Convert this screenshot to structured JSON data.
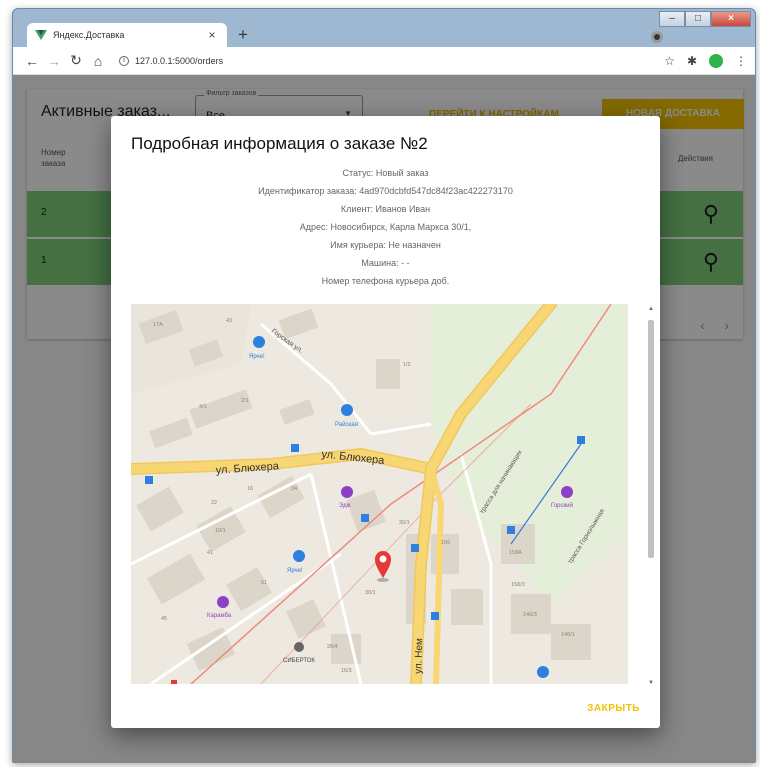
{
  "browser": {
    "tab_title": "Яндекс.Доставка",
    "tab_close": "×",
    "new_tab": "+",
    "url": "127.0.0.1:5000/orders",
    "win_minimize": "–",
    "win_maximize": "□",
    "win_close": "×"
  },
  "page": {
    "card_title": "Активные заказ...",
    "filter_label": "Фильтр заказов",
    "filter_value": "Все",
    "settings_link": "ПЕРЕЙТИ К НАСТРОЙКАМ",
    "new_delivery_button": "НОВАЯ ДОСТАВКА",
    "columns": {
      "order_number_1": "Номер",
      "order_number_2": "заказа",
      "actions": "Действия"
    },
    "rows": [
      {
        "num": "2"
      },
      {
        "num": "1"
      }
    ]
  },
  "dialog": {
    "title": "Подробная информация о заказе №2",
    "status": "Статус: Новый заказ",
    "order_id": "Идентификатор заказа: 4ad970dcbfd547dc84f23ac422273170",
    "client": "Клиент: Иванов Иван",
    "address": "Адрес: Новосибирск, Карла Маркса 30/1,",
    "courier_name": "Имя курьера: Не назначен",
    "car": "Машина: - -",
    "courier_phone": "Номер телефона курьера доб.",
    "close_button": "ЗАКРЫТЬ"
  },
  "map": {
    "street_1": "ул. Блюхера",
    "street_2": "ул. Блюхера",
    "street_3": "ул. Нем",
    "street_4": "Горская ул.",
    "trail_1": "трасса для начинающих",
    "trail_2": "трасса Горнолыжная",
    "poi_1": "Ярче!",
    "poi_2": "Райская",
    "poi_3": "Эдж",
    "poi_4": "Ярче!",
    "poi_5": "Горский",
    "poi_6": "Карамба",
    "poi_7": "СИБЕРТОК",
    "houses": [
      "17А",
      "43",
      "2/1",
      "4/1",
      "34",
      "16",
      "22",
      "1/2",
      "30/1",
      "30/1",
      "156",
      "158А",
      "158/3",
      "146/3",
      "146/1",
      "26/4",
      "16/3",
      "41",
      "45",
      "51",
      "10/1"
    ]
  },
  "colors": {
    "accent": "#f2c200",
    "row_highlight": "#7fcf7a",
    "road_major": "#f7d673",
    "marker": "#e53935"
  }
}
